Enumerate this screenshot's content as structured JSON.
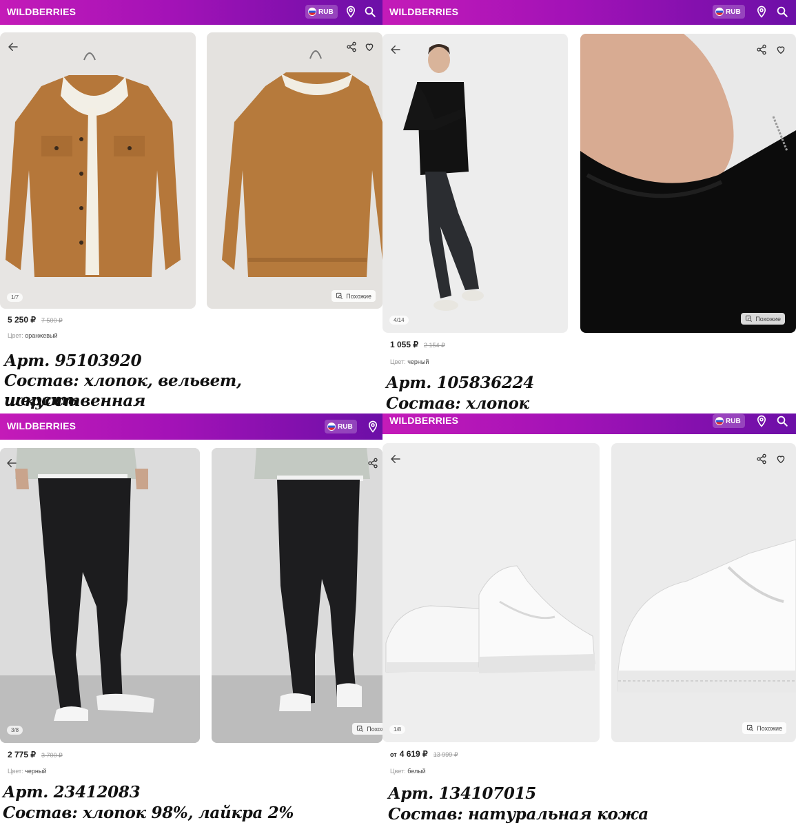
{
  "header": {
    "brand": "WILDBERRIES",
    "currency": "RUB"
  },
  "similar_label": "Похожие",
  "color_label": "Цвет:",
  "from_label": "от",
  "products": [
    {
      "pager": "1/7",
      "price": "5 250 ₽",
      "old_price": "7 500 ₽",
      "color": "оранжевый",
      "article": "Арт. 95103920",
      "composition_1": "Состав: хлопок, вельвет, искусственная",
      "composition_2": "шерсть"
    },
    {
      "pager": "4/14",
      "price": "1 055 ₽",
      "old_price": "2 154 ₽",
      "color": "черный",
      "article": "Арт. 105836224",
      "composition_1": "Состав: хлопок"
    },
    {
      "pager": "3/8",
      "price": "2 775 ₽",
      "old_price": "3 700 ₽",
      "color": "черный",
      "article": "Арт. 23412083",
      "composition_1": "Состав: хлопок 98%, лайкра 2%"
    },
    {
      "pager": "1/8",
      "price": "4 619 ₽",
      "old_price": "13 999 ₽",
      "color": "белый",
      "article": "Арт. 134107015",
      "composition_1": "Состав: натуральная кожа"
    }
  ],
  "colors": {
    "header_start": "#c41bb8",
    "header_end": "#6c0fa7",
    "price": "#222222",
    "muted": "#999999"
  },
  "icons": [
    "arrow-left-icon",
    "share-icon",
    "heart-icon",
    "location-pin-icon",
    "search-icon",
    "similar-search-icon",
    "russian-flag-icon"
  ]
}
